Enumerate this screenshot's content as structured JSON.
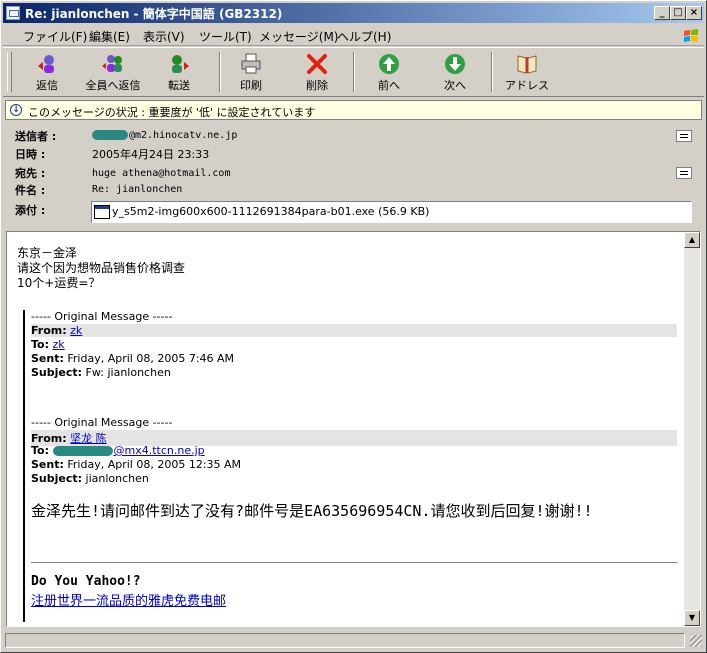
{
  "window": {
    "title": "Re: jianlonchen  - 簡体字中国語 (GB2312)",
    "controls": [
      "_",
      "□",
      "×"
    ]
  },
  "menu": [
    "ファイル(F)",
    "編集(E)",
    "表示(V)",
    "ツール(T)",
    "メッセージ(M)",
    "ヘルプ(H)"
  ],
  "toolbar": {
    "reply": "返信",
    "reply_all": "全員へ返信",
    "forward": "転送",
    "print": "印刷",
    "delete": "削除",
    "previous": "前へ",
    "next": "次へ",
    "address": "アドレス"
  },
  "infobar": {
    "text": "このメッセージの状況 : 重要度が '低' に設定されています"
  },
  "header": {
    "from_label": "送信者 :",
    "from_value": "@m2.hinocatv.ne.jp",
    "date_label": "日時 :",
    "date_value": "2005年4月24日 23:33",
    "to_label": "宛先 :",
    "to_value": "huge athena@hotmail.com",
    "subject_label": "件名 :",
    "subject_value": "Re: jianlonchen",
    "attach_label": "添付 :",
    "attach_value": "y_s5m2-img600x600-1112691384para-b01.exe (56.9 KB)"
  },
  "body": {
    "line1": "东京－金泽",
    "line2": "请这个因为想物品销售价格调查",
    "line3": "10个+运费=？",
    "quote1": {
      "divider": "----- Original Message -----",
      "from_label": "From:",
      "from_value": "zk",
      "to_label": "To:",
      "to_value": "zk",
      "sent_label": "Sent:",
      "sent_value": "Friday, April 08, 2005 7:46 AM",
      "subject_label": "Subject:",
      "subject_value": "Fw: jianlonchen"
    },
    "quote2": {
      "divider": "----- Original Message -----",
      "from_label": "From:",
      "from_value": "坚龙 陈",
      "to_label": "To:",
      "to_value": "@mx4.ttcn.ne.jp",
      "sent_label": "Sent:",
      "sent_value": "Friday, April 08, 2005 12:35 AM",
      "subject_label": "Subject:",
      "subject_value": "jianlonchen"
    },
    "main_text": "金泽先生!请问邮件到达了没有?邮件号是EA635696954CN.请您收到后回复!谢谢!!",
    "footer_title": "Do You Yahoo!?",
    "footer_link": "注册世界一流品质的雅虎免费电邮"
  }
}
